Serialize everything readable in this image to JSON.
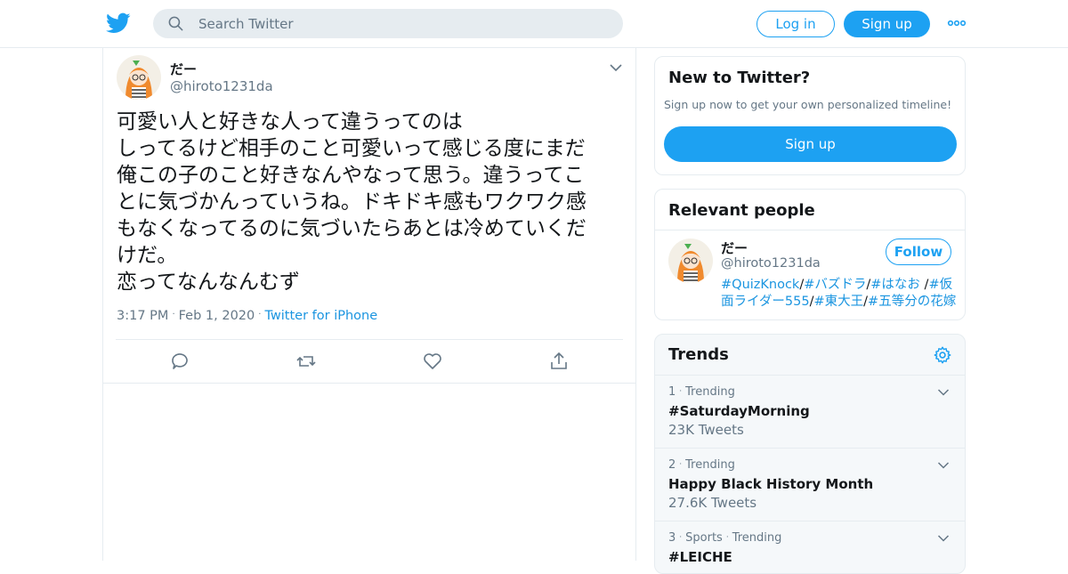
{
  "header": {
    "search_placeholder": "Search Twitter",
    "login_label": "Log in",
    "signup_label": "Sign up",
    "brand_color": "#1da1f2"
  },
  "tweet": {
    "author_name": "だー",
    "author_handle": "@hiroto1231da",
    "text": "可愛い人と好きな人って違うってのは\nしってるけど相手のこと可愛いって感じる度にまだ\n俺この子のこと好きなんやなって思う。違うってこ\nとに気づかんっていうね。ドキドキ感もワクワク感\nもなくなってるのに気づいたらあとは冷めていくだ\nけだ。\n恋ってなんなんむず",
    "time": "3:17 PM",
    "date": "Feb 1, 2020",
    "source": "Twitter for iPhone",
    "actions": [
      "reply-icon",
      "retweet-icon",
      "like-icon",
      "share-icon"
    ]
  },
  "new_to_twitter": {
    "title": "New to Twitter?",
    "subtitle": "Sign up now to get your own personalized timeline!",
    "signup_label": "Sign up"
  },
  "relevant_people": {
    "title": "Relevant people",
    "name": "だー",
    "handle": "@hiroto1231da",
    "follow_label": "Follow",
    "bio": {
      "tag1": "#QuizKnock",
      "sep1": "/",
      "tag2": "#バズドラ",
      "sep2": "/",
      "tag3": "#はなお",
      "sep3": " /",
      "tag4": "#仮面ライダー555",
      "sep4": "/",
      "tag5": "#東大王",
      "sep5": "/",
      "tag6": "#五等分の花嫁"
    }
  },
  "trends": {
    "title": "Trends",
    "items": [
      {
        "rank": "1",
        "context": "Trending",
        "category": "",
        "name": "#SaturdayMorning",
        "count": "23K Tweets"
      },
      {
        "rank": "2",
        "context": "Trending",
        "category": "",
        "name": "Happy Black History Month",
        "count": "27.6K Tweets"
      },
      {
        "rank": "3",
        "context": "Trending",
        "category": "Sports",
        "name": "#LEICHE",
        "count": ""
      }
    ]
  }
}
